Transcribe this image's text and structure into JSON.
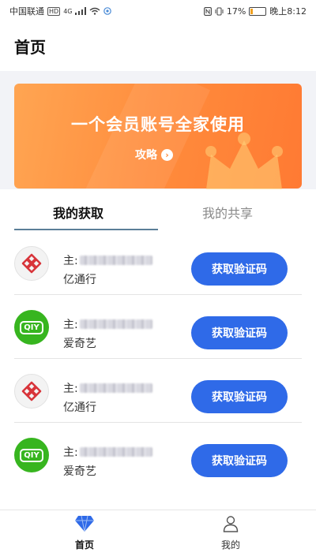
{
  "status_bar": {
    "carrier": "中国联通",
    "hd_badge": "HD",
    "network": "4G",
    "battery": "17%",
    "battery_level": 0.17,
    "time": "晚上8:12"
  },
  "header": {
    "title": "首页"
  },
  "banner": {
    "title": "一个会员账号全家使用",
    "link_label": "攻略",
    "link_arrow": "›"
  },
  "tabs": [
    {
      "label": "我的获取",
      "active": true
    },
    {
      "label": "我的共享",
      "active": false
    }
  ],
  "items": [
    {
      "owner_prefix": "主:",
      "app": "亿通行",
      "button": "获取验证码",
      "icon": "yitongxing-logo-icon"
    },
    {
      "owner_prefix": "主:",
      "app": "爱奇艺",
      "button": "获取验证码",
      "icon": "iqiyi-logo-icon",
      "logo_text": "QIY"
    },
    {
      "owner_prefix": "主:",
      "app": "亿通行",
      "button": "获取验证码",
      "icon": "yitongxing-logo-icon"
    },
    {
      "owner_prefix": "主:",
      "app": "爱奇艺",
      "button": "获取验证码",
      "icon": "iqiyi-logo-icon",
      "logo_text": "QIY"
    }
  ],
  "bottom_nav": [
    {
      "label": "首页",
      "icon": "diamond-icon",
      "active": true
    },
    {
      "label": "我的",
      "icon": "user-icon",
      "active": false
    }
  ],
  "colors": {
    "accent_blue": "#2f6ae8",
    "banner_orange": "#ff8a3b",
    "iqiyi_green": "#37b51f",
    "yitongxing_red": "#d8343a"
  }
}
